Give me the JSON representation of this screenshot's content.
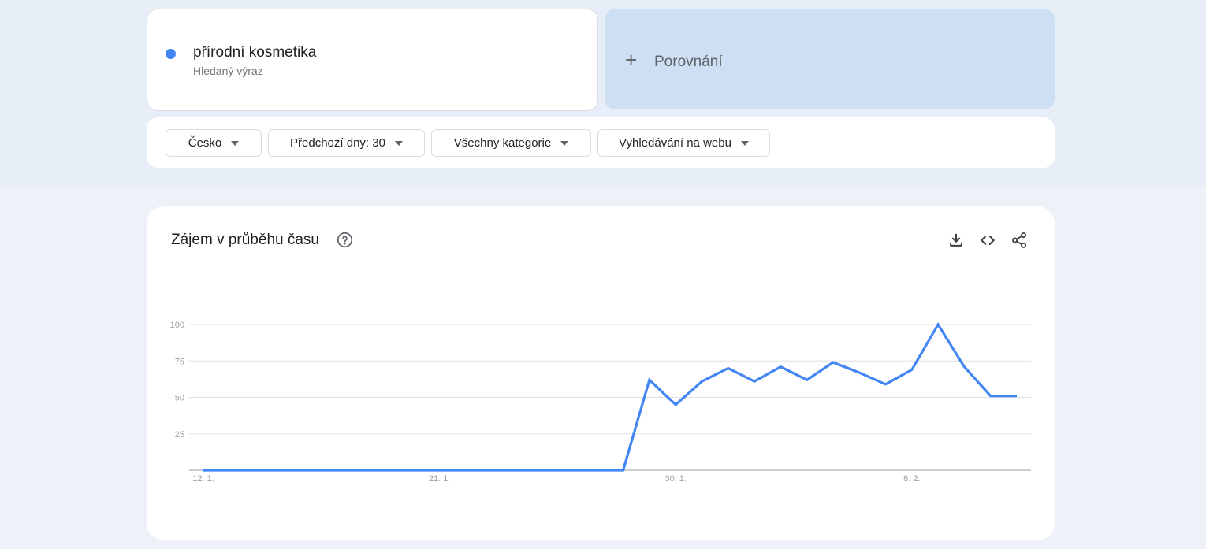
{
  "term": {
    "title": "přírodní kosmetika",
    "subtitle": "Hledaný výraz",
    "color": "#4285f4"
  },
  "compare": {
    "label": "Porovnání",
    "icon": "plus-icon"
  },
  "filters": [
    {
      "label": "Česko"
    },
    {
      "label": "Předchozí dny: 30"
    },
    {
      "label": "Všechny kategorie"
    },
    {
      "label": "Vyhledávání na webu"
    }
  ],
  "chart_panel": {
    "title": "Zájem v průběhu času",
    "icons": [
      "help-icon",
      "download-icon",
      "embed-icon",
      "share-icon"
    ]
  },
  "chart_data": {
    "type": "line",
    "x_tick_labels": [
      "12. 1.",
      "21. 1.",
      "30. 1.",
      "8. 2."
    ],
    "y_tick_labels": [
      "100",
      "75",
      "50",
      "25"
    ],
    "ylim": [
      0,
      100
    ],
    "grid": true,
    "line_color": "#4285f4",
    "series": [
      {
        "values": [
          0,
          0,
          0,
          0,
          0,
          0,
          0,
          0,
          0,
          0,
          0,
          0,
          0,
          0,
          0,
          0,
          0,
          62,
          45,
          61,
          70,
          61,
          71,
          62,
          74,
          67,
          59,
          69,
          100,
          71,
          51,
          51
        ]
      }
    ]
  }
}
